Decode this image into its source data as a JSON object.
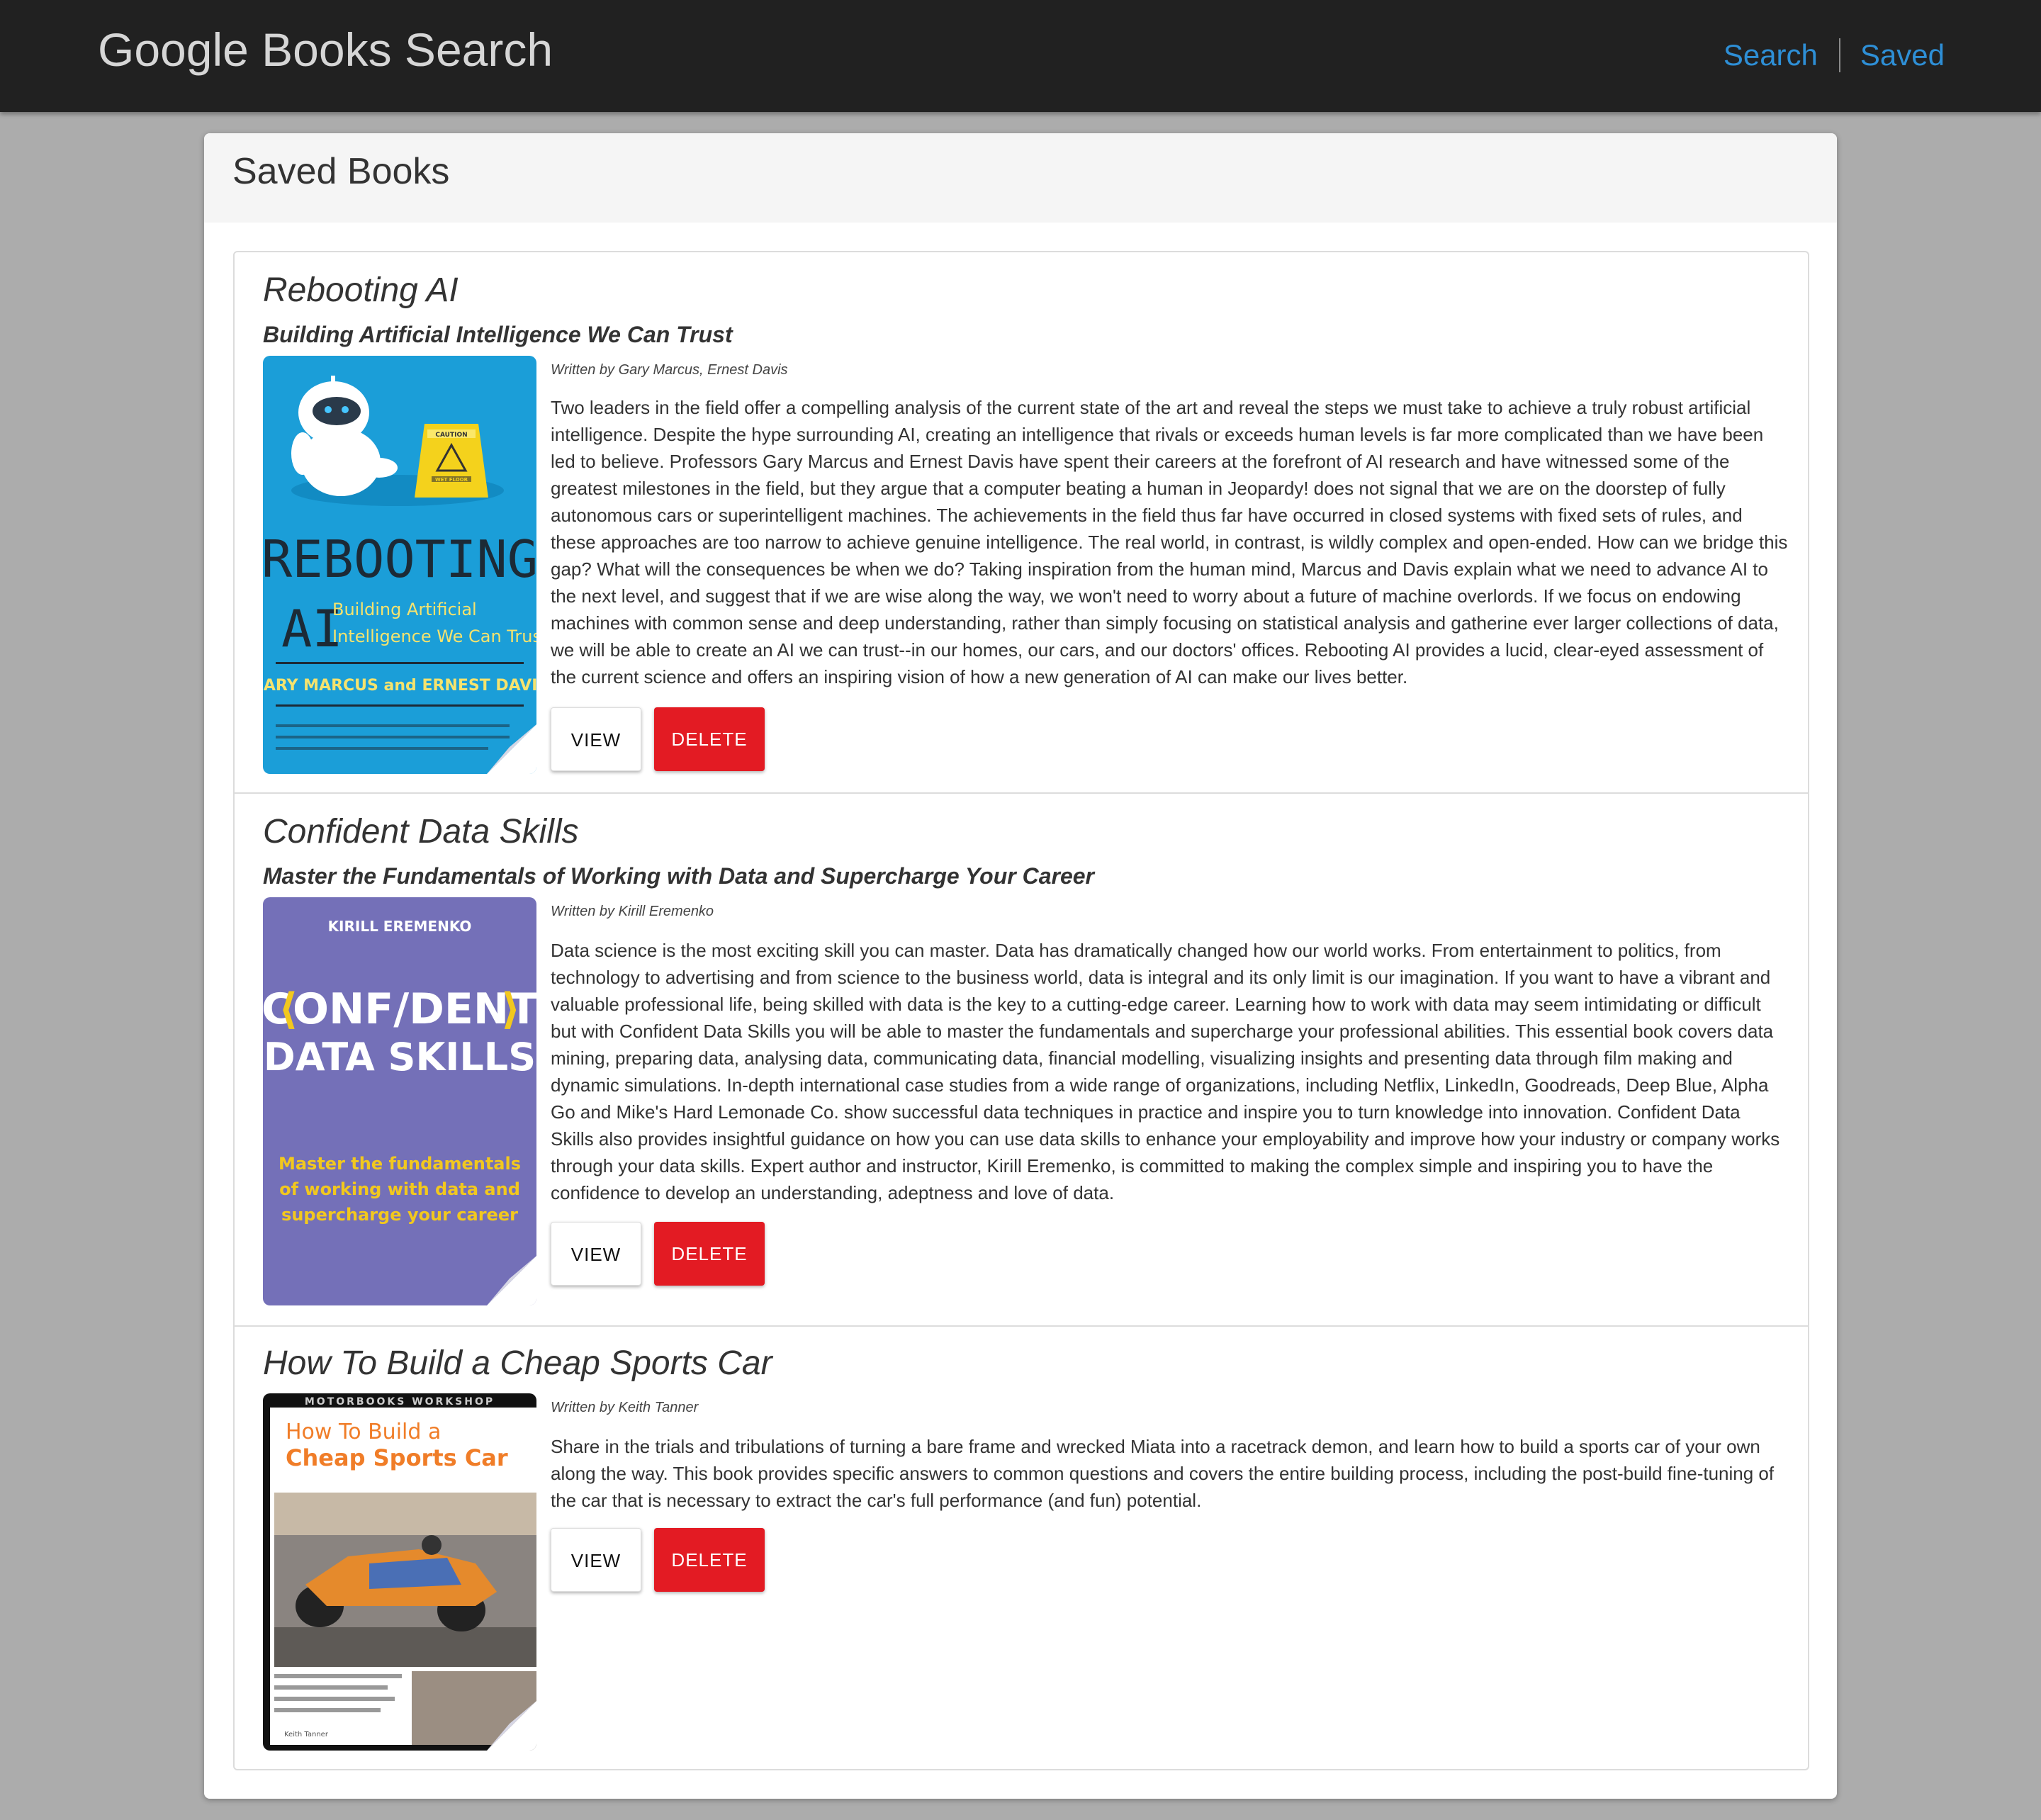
{
  "nav": {
    "brand": "Google Books Search",
    "links": [
      "Search",
      "Saved"
    ]
  },
  "panel": {
    "title": "Saved Books"
  },
  "books": [
    {
      "title": "Rebooting AI",
      "subtitle": "Building Artificial Intelligence We Can Trust",
      "author": "Written by Gary Marcus, Ernest Davis",
      "description": "Two leaders in the field offer a compelling analysis of the current state of the art and reveal the steps we must take to achieve a truly robust artificial intelligence. Despite the hype surrounding AI, creating an intelligence that rivals or exceeds human levels is far more complicated than we have been led to believe. Professors Gary Marcus and Ernest Davis have spent their careers at the forefront of AI research and have witnessed some of the greatest milestones in the field, but they argue that a computer beating a human in Jeopardy! does not signal that we are on the doorstep of fully autonomous cars or superintelligent machines. The achievements in the field thus far have occurred in closed systems with fixed sets of rules, and these approaches are too narrow to achieve genuine intelligence. The real world, in contrast, is wildly complex and open-ended. How can we bridge this gap? What will the consequences be when we do? Taking inspiration from the human mind, Marcus and Davis explain what we need to advance AI to the next level, and suggest that if we are wise along the way, we won't need to worry about a future of machine overlords. If we focus on endowing machines with common sense and deep understanding, rather than simply focusing on statistical analysis and gatherine ever larger collections of data, we will be able to create an AI we can trust--in our homes, our cars, and our doctors' offices. Rebooting AI provides a lucid, clear-eyed assessment of the current science and offers an inspiring vision of how a new generation of AI can make our lives better.",
      "view_label": "VIEW",
      "delete_label": "DELETE",
      "cover": {
        "bg": "#1b9ed8",
        "line1": "REBOOTING",
        "line2": "AI",
        "tag1": "Building Artificial",
        "tag2": "Intelligence We Can Trust",
        "authors": "GARY MARCUS and ERNEST DAVIS",
        "caution": "CAUTION",
        "wet_floor": "WET FLOOR"
      }
    },
    {
      "title": "Confident Data Skills",
      "subtitle": "Master the Fundamentals of Working with Data and Supercharge Your Career",
      "author": "Written by Kirill Eremenko",
      "description": "Data science is the most exciting skill you can master. Data has dramatically changed how our world works. From entertainment to politics, from technology to advertising and from science to the business world, data is integral and its only limit is our imagination. If you want to have a vibrant and valuable professional life, being skilled with data is the key to a cutting-edge career. Learning how to work with data may seem intimidating or difficult but with Confident Data Skills you will be able to master the fundamentals and supercharge your professional abilities. This essential book covers data mining, preparing data, analysing data, communicating data, financial modelling, visualizing insights and presenting data through film making and dynamic simulations. In-depth international case studies from a wide range of organizations, including Netflix, LinkedIn, Goodreads, Deep Blue, Alpha Go and Mike's Hard Lemonade Co. show successful data techniques in practice and inspire you to turn knowledge into innovation. Confident Data Skills also provides insightful guidance on how you can use data skills to enhance your employability and improve how your industry or company works through your data skills. Expert author and instructor, Kirill Eremenko, is committed to making the complex simple and inspiring you to have the confidence to develop an understanding, adeptness and love of data.",
      "view_label": "VIEW",
      "delete_label": "DELETE",
      "cover": {
        "bg": "#7470b8",
        "author": "KIRILL EREMENKO",
        "line1": "CONF/DENT",
        "line2": "DATA SKILLS",
        "tag1": "Master the fundamentals",
        "tag2": "of working with data and",
        "tag3": "supercharge your career"
      }
    },
    {
      "title": "How To Build a Cheap Sports Car",
      "subtitle": "",
      "author": "Written by Keith Tanner",
      "description": "Share in the trials and tribulations of turning a bare frame and wrecked Miata into a racetrack demon, and learn how to build a sports car of your own along the way. This book provides specific answers to common questions and covers the entire building process, including the post-build fine-tuning of the car that is necessary to extract the car's full performance (and fun) potential.",
      "view_label": "VIEW",
      "delete_label": "DELETE",
      "cover": {
        "bg": "#ffffff",
        "series": "MOTORBOOKS WORKSHOP",
        "line1": "How To Build a",
        "line2": "Cheap Sports Car",
        "author": "Keith Tanner"
      }
    }
  ]
}
